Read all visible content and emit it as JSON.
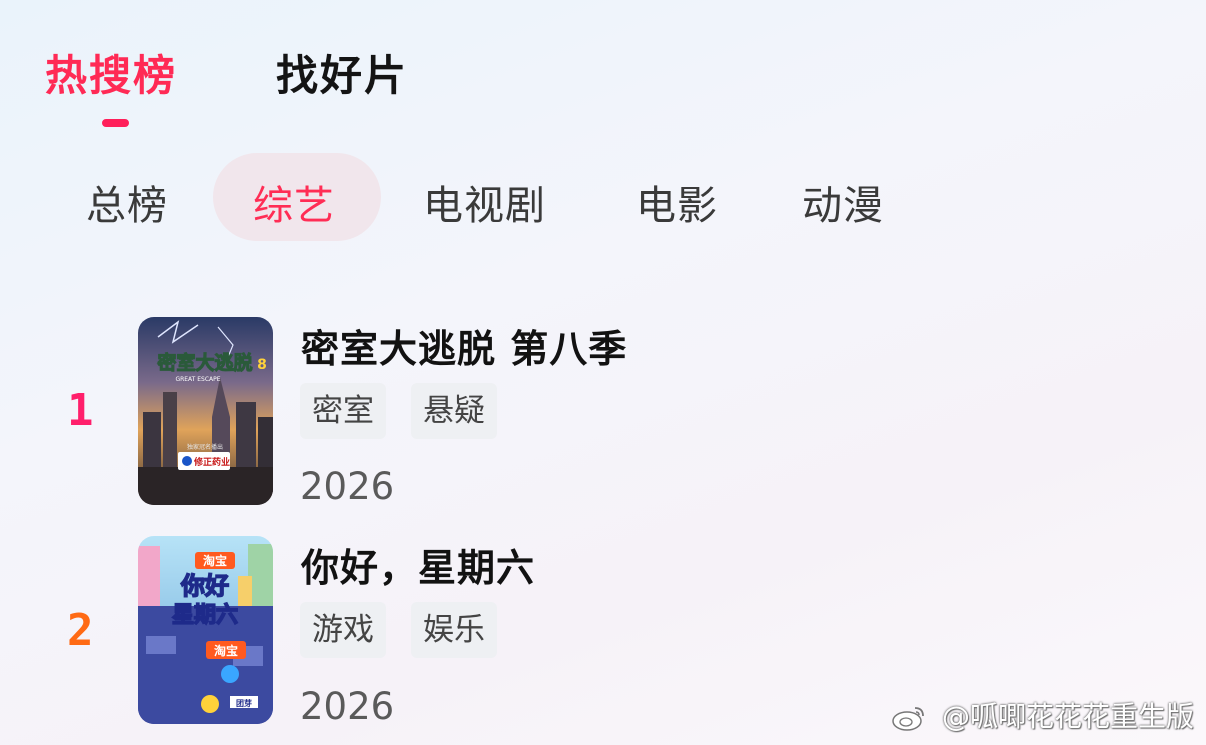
{
  "top_tabs": {
    "hot": "热搜榜",
    "find": "找好片"
  },
  "sub_tabs": [
    "总榜",
    "综艺",
    "电视剧",
    "电影",
    "动漫"
  ],
  "colors": {
    "accent": "#ff2a55",
    "rank1": "#ff1f6b",
    "rank2": "#ff6a14"
  },
  "items": [
    {
      "rank": "1",
      "title": "密室大逃脱 第八季",
      "tags": [
        "密室",
        "悬疑"
      ],
      "year": "2026",
      "poster": {
        "title_art": "密室大逃脱",
        "season_mark": "8",
        "english": "GREAT ESCAPE",
        "sponsor_caption": "独家冠名播出",
        "sponsor": "修正药业"
      }
    },
    {
      "rank": "2",
      "title": "你好，星期六",
      "tags": [
        "游戏",
        "娱乐"
      ],
      "year": "2026",
      "poster": {
        "brand_top": "淘宝",
        "title_line1": "你好",
        "title_line2": "星期六",
        "brand_mid": "淘宝",
        "logo": "团芽"
      }
    }
  ],
  "watermark": "@呱唧花花花重生版"
}
